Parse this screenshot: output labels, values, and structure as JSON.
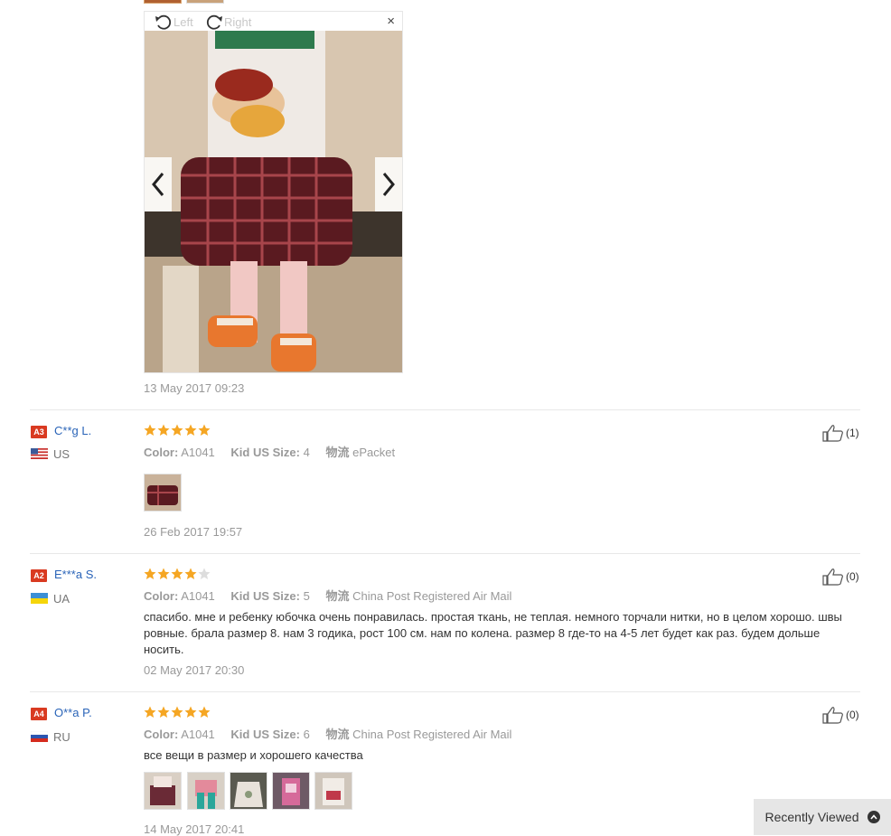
{
  "viewer": {
    "rotate_left": "Left",
    "rotate_right": "Right",
    "close": "×"
  },
  "reviews": [
    {
      "date": "13 May 2017 09:23"
    },
    {
      "badge": "A3",
      "name": "C**g L.",
      "country": "US",
      "rating": 5,
      "color_label": "Color:",
      "color_value": "A1041",
      "size_label": "Kid US Size:",
      "size_value": "4",
      "ship_label": "物流",
      "ship_value": "ePacket",
      "likes": "(1)",
      "date": "26 Feb 2017 19:57"
    },
    {
      "badge": "A2",
      "name": "E***a S.",
      "country": "UA",
      "rating": 4,
      "color_label": "Color:",
      "color_value": "A1041",
      "size_label": "Kid US Size:",
      "size_value": "5",
      "ship_label": "物流",
      "ship_value": "China Post Registered Air Mail",
      "text": "спасибо. мне и ребенку юбочка очень понравилась. простая ткань, не теплая. немного торчали нитки, но в целом хорошо. швы ровные. брала размер 8. нам 3 годика, рост 100 см. нам по колена. размер 8 где-то на 4-5 лет будет как раз. будем дольше носить.",
      "likes": "(0)",
      "date": "02 May 2017 20:30"
    },
    {
      "badge": "A4",
      "name": "O**a P.",
      "country": "RU",
      "rating": 5,
      "color_label": "Color:",
      "color_value": "A1041",
      "size_label": "Kid US Size:",
      "size_value": "6",
      "ship_label": "物流",
      "ship_value": "China Post Registered Air Mail",
      "text": "все вещи в размер и хорошего качества",
      "likes": "(0)",
      "date": "14 May 2017 20:41"
    }
  ],
  "recently_viewed": "Recently Viewed",
  "colors": {
    "star": "#f5a623",
    "star_empty": "#dddddd",
    "badge": "#d93a21",
    "link": "#2a64b8"
  }
}
